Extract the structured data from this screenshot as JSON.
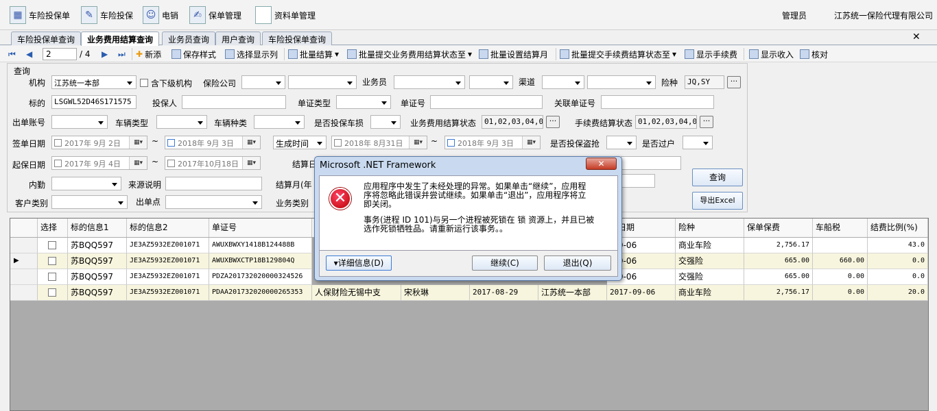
{
  "topbar": {
    "items": [
      "车险投保单",
      "车险投保",
      "电销",
      "保单管理",
      "资料单管理"
    ],
    "user": "管理员",
    "company": "江苏统一保险代理有限公司"
  },
  "tabs": [
    "车险投保单查询",
    "业务费用结算查询",
    "业务员查询",
    "用户查询",
    "车险投保单查询"
  ],
  "toolbar": {
    "page": "2",
    "total": "/ 4",
    "actions": [
      "新添",
      "保存样式",
      "选择显示列",
      "批量结算",
      "批量提交业务费用结算状态至",
      "批量设置结算月",
      "批量提交手续费结算状态至",
      "显示手续费",
      "显示收入",
      "核对"
    ]
  },
  "query": {
    "title": "查询",
    "org_label": "机构",
    "org_value": "江苏统一本部",
    "sub_org_label": "含下级机构",
    "insurer_label": "保险公司",
    "salesman_label": "业务员",
    "channel_label": "渠道",
    "risk_label": "险种",
    "risk_value": "JQ,SY",
    "target_label": "标的",
    "target_value": "LSGWL52D46S171575",
    "applicant_label": "投保人",
    "doc_type_label": "单证类型",
    "doc_no_label": "单证号",
    "rel_doc_label": "关联单证号",
    "account_label": "出单账号",
    "vehicle_type_label": "车辆类型",
    "vehicle_kind_label": "车辆种类",
    "vehicle_loss_label": "是否投保车损",
    "fee_status_label": "业务费用结算状态",
    "fee_status_value": "01,02,03,04,05",
    "comm_status_label": "手续费结算状态",
    "comm_status_value": "01,02,03,04,05",
    "sign_date_label": "签单日期",
    "sign_from": "2017年 9月 2日",
    "sign_to": "2018年 9月 3日",
    "gen_time_label": "生成时间",
    "gen_from": "2018年 8月31日",
    "gen_to": "2018年 9月 3日",
    "theft_label": "是否投保盗抢",
    "transfer_label": "是否过户",
    "start_date_label": "起保日期",
    "start_from": "2017年 9月 4日",
    "start_to": "2017年10月18日",
    "settle_label": "结算日",
    "internal_label": "内勤",
    "source_label": "来源说明",
    "settle_month_label": "结算月(年",
    "customer_label": "客户类别",
    "point_label": "出单点",
    "biz_type_label": "业务类别",
    "query_btn": "查询",
    "export_btn": "导出Excel",
    "tilde": "~"
  },
  "grid": {
    "columns": [
      "选择",
      "标的信息1",
      "标的信息2",
      "单证号",
      "",
      "",
      "",
      "",
      "保日期",
      "险种",
      "保单保费",
      "车船税",
      "结费比例(%)"
    ],
    "rows": [
      {
        "c1": "苏BQQ597",
        "c2": "JE3AZ5932EZ001071",
        "c3": "AWUXBWXY1418B124488B",
        "c4": "",
        "c5": "",
        "c6": "",
        "c7": "",
        "c8": "-09-06",
        "c9": "商业车险",
        "c10": "2,756.17",
        "c11": "",
        "c12": "43.0"
      },
      {
        "c1": "苏BQQ597",
        "c2": "JE3AZ5932EZ001071",
        "c3": "AWUXBWXCTP18B129804Q",
        "c4": "",
        "c5": "",
        "c6": "",
        "c7": "",
        "c8": "-09-06",
        "c9": "交强险",
        "c10": "665.00",
        "c11": "660.00",
        "c12": "0.0"
      },
      {
        "c1": "苏BQQ597",
        "c2": "JE3AZ5932EZ001071",
        "c3": "PDZA201732020000324526",
        "c4": "",
        "c5": "",
        "c6": "",
        "c7": "",
        "c8": "-09-06",
        "c9": "交强险",
        "c10": "665.00",
        "c11": "0.00",
        "c12": "0.0"
      },
      {
        "c1": "苏BQQ597",
        "c2": "JE3AZ5932EZ001071",
        "c3": "PDAA201732020000265353",
        "c4": "人保财险无锡中支",
        "c5": "宋秋琳",
        "c6": "2017-08-29",
        "c7": "江苏统一本部",
        "c8": "2017-09-06",
        "c9": "商业车险",
        "c10": "2,756.17",
        "c11": "0.00",
        "c12": "20.0"
      }
    ]
  },
  "dialog": {
    "title": "Microsoft .NET Framework",
    "close": "✕",
    "line1": "应用程序中发生了未经处理的异常。如果单击“继续”，应用程",
    "line2": "序将忽略此错误并尝试继续。如果单击“退出”，应用程序将立",
    "line3": "即关闭。",
    "line4": "事务(进程 ID 101)与另一个进程被死锁在 锁 资源上，并且已被",
    "line5": "选作死锁牺牲品。请重新运行该事务。。",
    "details_btn": "▾详细信息(D)",
    "continue_btn": "继续(C)",
    "exit_btn": "退出(Q)"
  }
}
